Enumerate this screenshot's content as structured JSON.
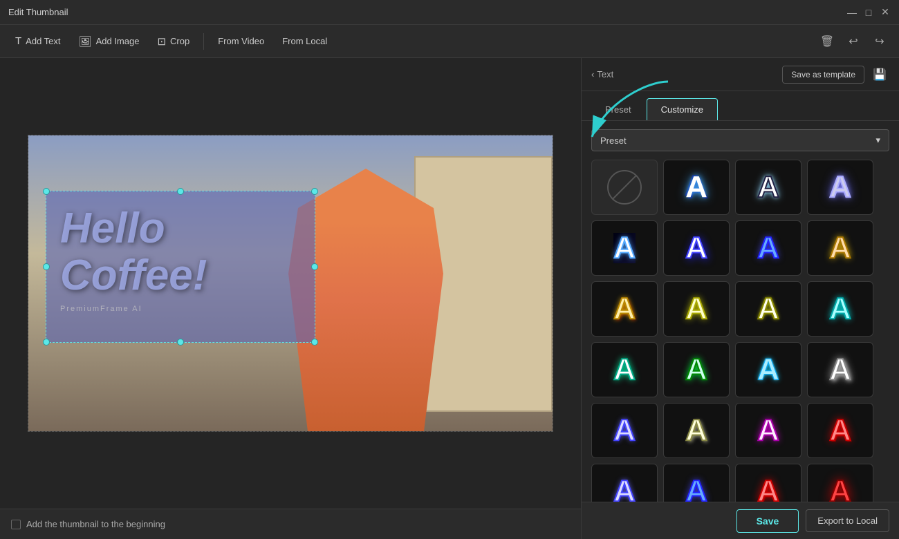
{
  "titleBar": {
    "title": "Edit Thumbnail",
    "minimizeBtn": "—",
    "maximizeBtn": "□",
    "closeBtn": "✕"
  },
  "toolbar": {
    "addText": "Add Text",
    "addImage": "Add Image",
    "crop": "Crop",
    "fromVideo": "From Video",
    "fromLocal": "From Local"
  },
  "canvas": {
    "overlayText": "Hello\nCoffee!",
    "watermark": "PremiumFrame AI"
  },
  "bottomBar": {
    "checkboxLabel": "Add the thumbnail to the beginning"
  },
  "panel": {
    "backLabel": "Text",
    "saveTemplateBtn": "Save as template",
    "tabPreset": "Preset",
    "tabCustomize": "Customize",
    "presetDropdownLabel": "Preset",
    "saveBtn": "Save",
    "exportBtn": "Export to Local"
  }
}
